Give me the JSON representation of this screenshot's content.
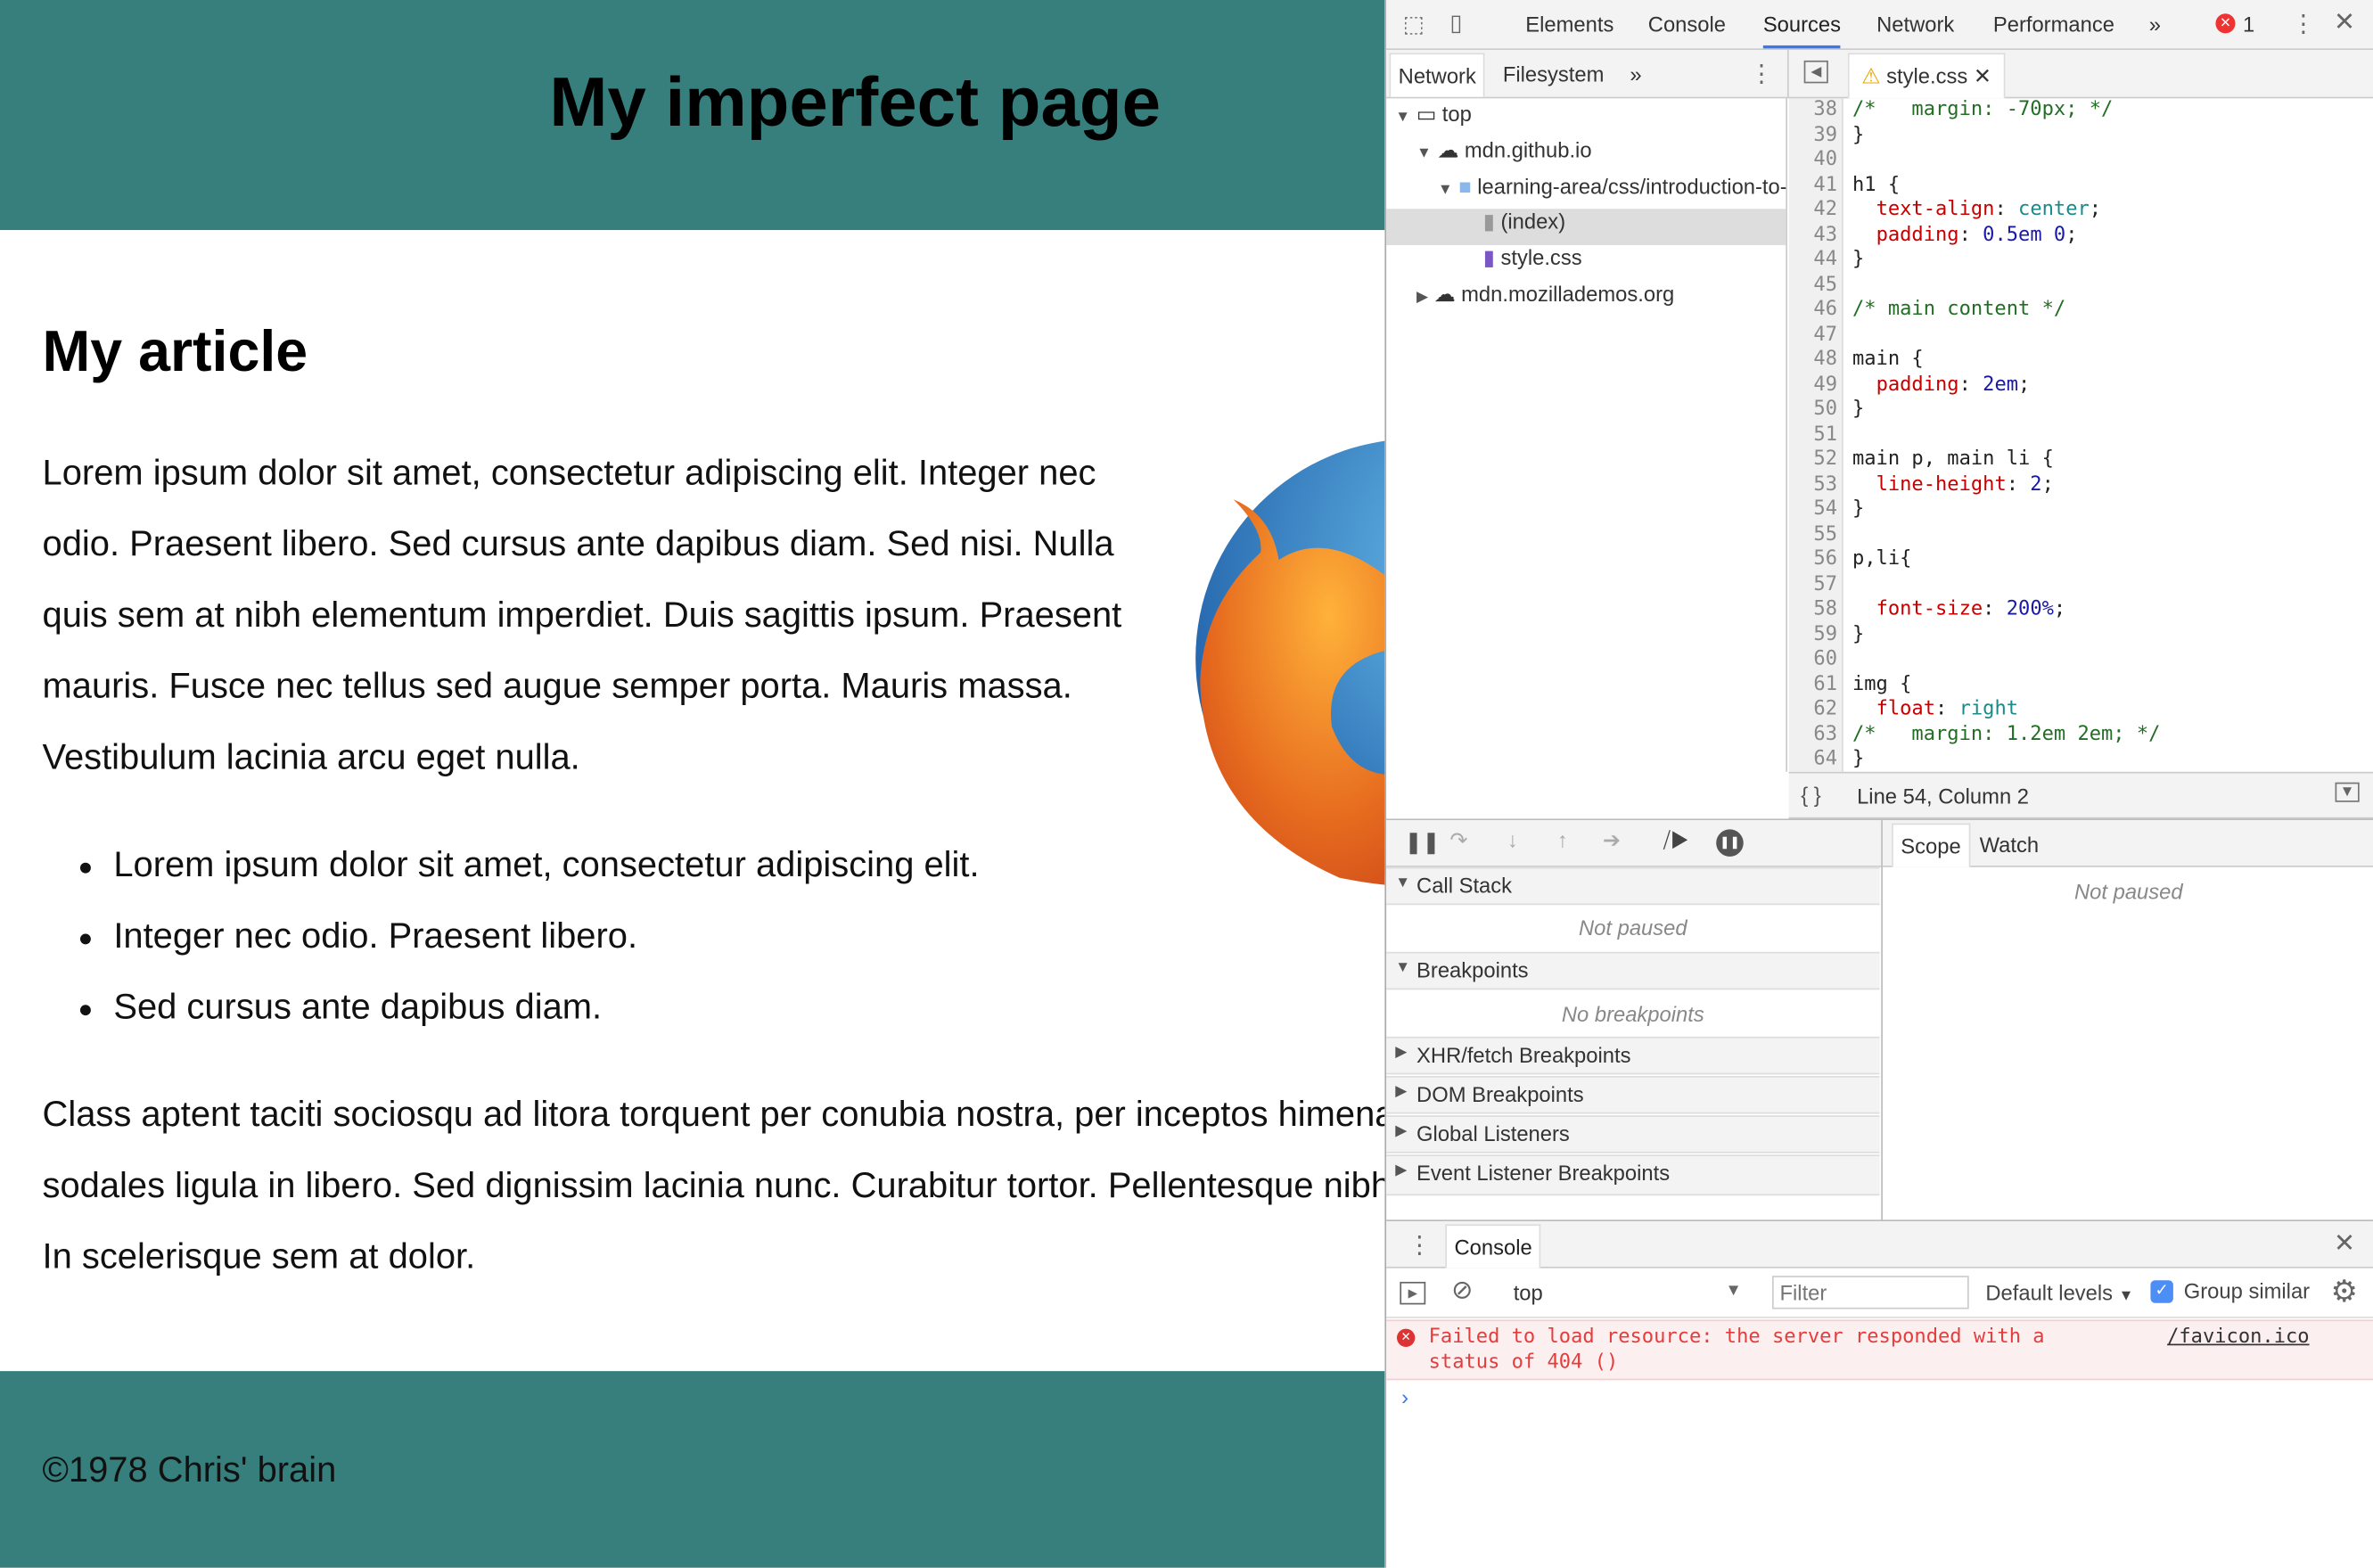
{
  "page": {
    "title": "My imperfect page",
    "article_heading": "My article",
    "paragraph1": [
      "Lorem ipsum dolor sit amet, consectetur adipiscing elit. Integer nec",
      "odio. Praesent libero. Sed cursus ante dapibus diam. Sed nisi. Nulla",
      "quis sem at nibh elementum imperdiet. Duis sagittis ipsum. Praesent",
      "mauris. Fusce nec tellus sed augue semper porta. Mauris massa.",
      "Vestibulum lacinia arcu eget nulla."
    ],
    "list": [
      "Lorem ipsum dolor sit amet, consectetur adipiscing elit.",
      "Integer nec odio. Praesent libero.",
      "Sed cursus ante dapibus diam."
    ],
    "paragraph2": [
      "Class aptent taciti sociosqu ad litora torquent per conubia nostra, per inceptos himenaeos. Curabitur",
      "sodales ligula in libero. Sed dignissim lacinia nunc. Curabitur tortor. Pellentesque nibh. Aenean quam.",
      "In scelerisque sem at dolor."
    ],
    "footer": "©1978 Chris' brain",
    "header_color": "#367f7d"
  },
  "devtools": {
    "tabs": [
      "Elements",
      "Console",
      "Sources",
      "Network",
      "Performance"
    ],
    "active_tab": "Sources",
    "more": "»",
    "error_count": "1",
    "navigator_tabs": [
      "Network",
      "Filesystem"
    ],
    "tree": [
      "top",
      "mdn.github.io",
      "learning-area/css/introduction-to-css",
      "(index)",
      "style.css",
      "mdn.mozillademos.org"
    ],
    "open_file": "style.css",
    "code": [
      {
        "n": "38",
        "t": [
          [
            "c",
            "/*   margin: -70px; */"
          ]
        ]
      },
      {
        "n": "39",
        "t": [
          [
            "k",
            "}"
          ]
        ]
      },
      {
        "n": "40",
        "t": []
      },
      {
        "n": "41",
        "t": [
          [
            "k",
            "h1 {"
          ]
        ]
      },
      {
        "n": "42",
        "t": [
          [
            "k",
            "  "
          ],
          [
            "p",
            "text-align"
          ],
          [
            "k",
            ": "
          ],
          [
            "s",
            "center"
          ],
          [
            "k",
            ";"
          ]
        ]
      },
      {
        "n": "43",
        "t": [
          [
            "k",
            "  "
          ],
          [
            "p",
            "padding"
          ],
          [
            "k",
            ": "
          ],
          [
            "v",
            "0.5em 0"
          ],
          [
            "k",
            ";"
          ]
        ]
      },
      {
        "n": "44",
        "t": [
          [
            "k",
            "}"
          ]
        ]
      },
      {
        "n": "45",
        "t": []
      },
      {
        "n": "46",
        "t": [
          [
            "c",
            "/* main content */"
          ]
        ]
      },
      {
        "n": "47",
        "t": []
      },
      {
        "n": "48",
        "t": [
          [
            "k",
            "main {"
          ]
        ]
      },
      {
        "n": "49",
        "t": [
          [
            "k",
            "  "
          ],
          [
            "p",
            "padding"
          ],
          [
            "k",
            ": "
          ],
          [
            "v",
            "2em"
          ],
          [
            "k",
            ";"
          ]
        ]
      },
      {
        "n": "50",
        "t": [
          [
            "k",
            "}"
          ]
        ]
      },
      {
        "n": "51",
        "t": []
      },
      {
        "n": "52",
        "t": [
          [
            "k",
            "main p, main li {"
          ]
        ]
      },
      {
        "n": "53",
        "t": [
          [
            "k",
            "  "
          ],
          [
            "p",
            "line-height"
          ],
          [
            "k",
            ": "
          ],
          [
            "v",
            "2"
          ],
          [
            "k",
            ";"
          ]
        ]
      },
      {
        "n": "54",
        "t": [
          [
            "k",
            "}"
          ]
        ]
      },
      {
        "n": "55",
        "t": []
      },
      {
        "n": "56",
        "t": [
          [
            "k",
            "p,li{"
          ]
        ]
      },
      {
        "n": "57",
        "t": []
      },
      {
        "n": "58",
        "t": [
          [
            "k",
            "  "
          ],
          [
            "p",
            "font-size"
          ],
          [
            "k",
            ": "
          ],
          [
            "v",
            "200%"
          ],
          [
            "k",
            ";"
          ]
        ]
      },
      {
        "n": "59",
        "t": [
          [
            "k",
            "}"
          ]
        ]
      },
      {
        "n": "60",
        "t": []
      },
      {
        "n": "61",
        "t": [
          [
            "k",
            "img {"
          ]
        ]
      },
      {
        "n": "62",
        "t": [
          [
            "k",
            "  "
          ],
          [
            "p",
            "float"
          ],
          [
            "k",
            ": "
          ],
          [
            "s",
            "right"
          ]
        ]
      },
      {
        "n": "63",
        "t": [
          [
            "c",
            "/*   margin: 1.2em 2em; */"
          ]
        ]
      },
      {
        "n": "64",
        "t": [
          [
            "k",
            "}"
          ]
        ]
      }
    ],
    "status": "Line 54, Column 2",
    "sections": {
      "call_stack": "Call Stack",
      "not_paused": "Not paused",
      "breakpoints": "Breakpoints",
      "no_breakpoints": "No breakpoints",
      "xhr": "XHR/fetch Breakpoints",
      "dom": "DOM Breakpoints",
      "global": "Global Listeners",
      "event": "Event Listener Breakpoints"
    },
    "scope_tabs": [
      "Scope",
      "Watch"
    ],
    "scope_empty": "Not paused",
    "console": {
      "tab": "Console",
      "context": "top",
      "filter_placeholder": "Filter",
      "levels": "Default levels",
      "group_similar": "Group similar",
      "group_checked": true,
      "error_line1": "Failed to load resource: the server responded with a",
      "error_line2": "status of 404 ()",
      "error_source": "/favicon.ico"
    }
  }
}
